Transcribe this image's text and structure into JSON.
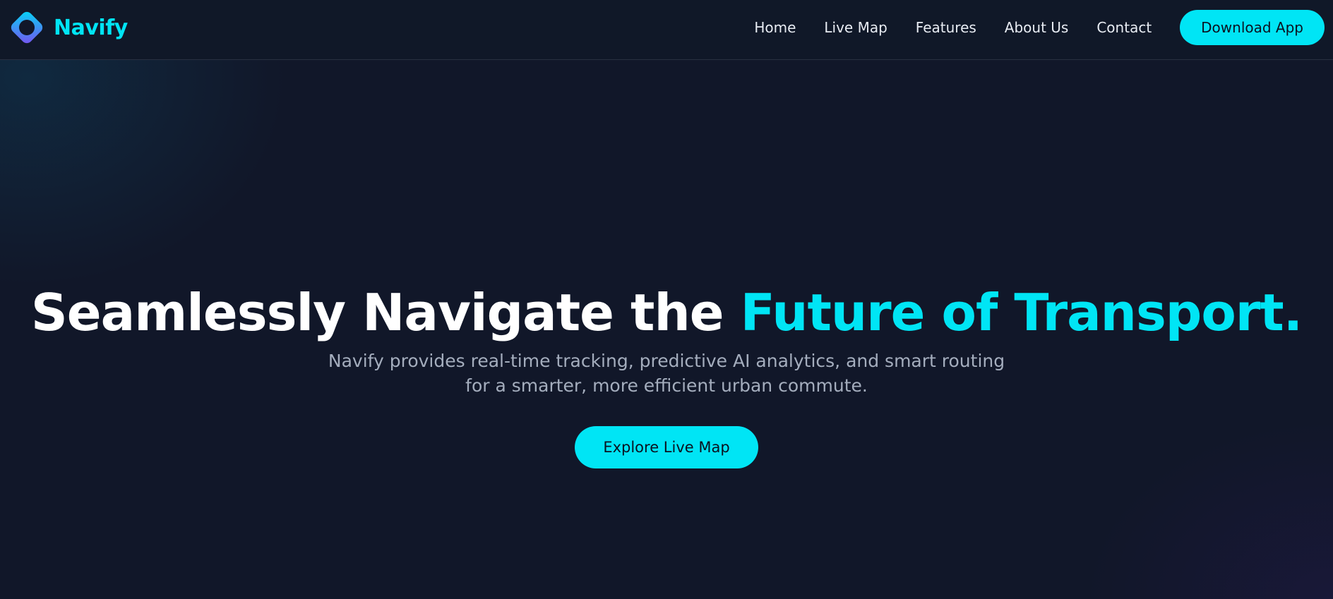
{
  "brand": {
    "name": "Navify",
    "icon": "navify-logo-diamond",
    "accent_color": "#00e5f5"
  },
  "nav": {
    "items": [
      {
        "label": "Home"
      },
      {
        "label": "Live Map"
      },
      {
        "label": "Features"
      },
      {
        "label": "About Us"
      },
      {
        "label": "Contact"
      }
    ],
    "cta_label": "Download App"
  },
  "hero": {
    "title_main": "Seamlessly Navigate the ",
    "title_accent": "Future of Transport.",
    "subtitle": "Navify provides real-time tracking, predictive AI analytics, and smart routing for a smarter, more efficient urban commute.",
    "cta_label": "Explore Live Map"
  },
  "colors": {
    "background": "#111729",
    "accent": "#00e5f5",
    "text_primary": "#ffffff",
    "text_secondary": "#a4adbd"
  }
}
